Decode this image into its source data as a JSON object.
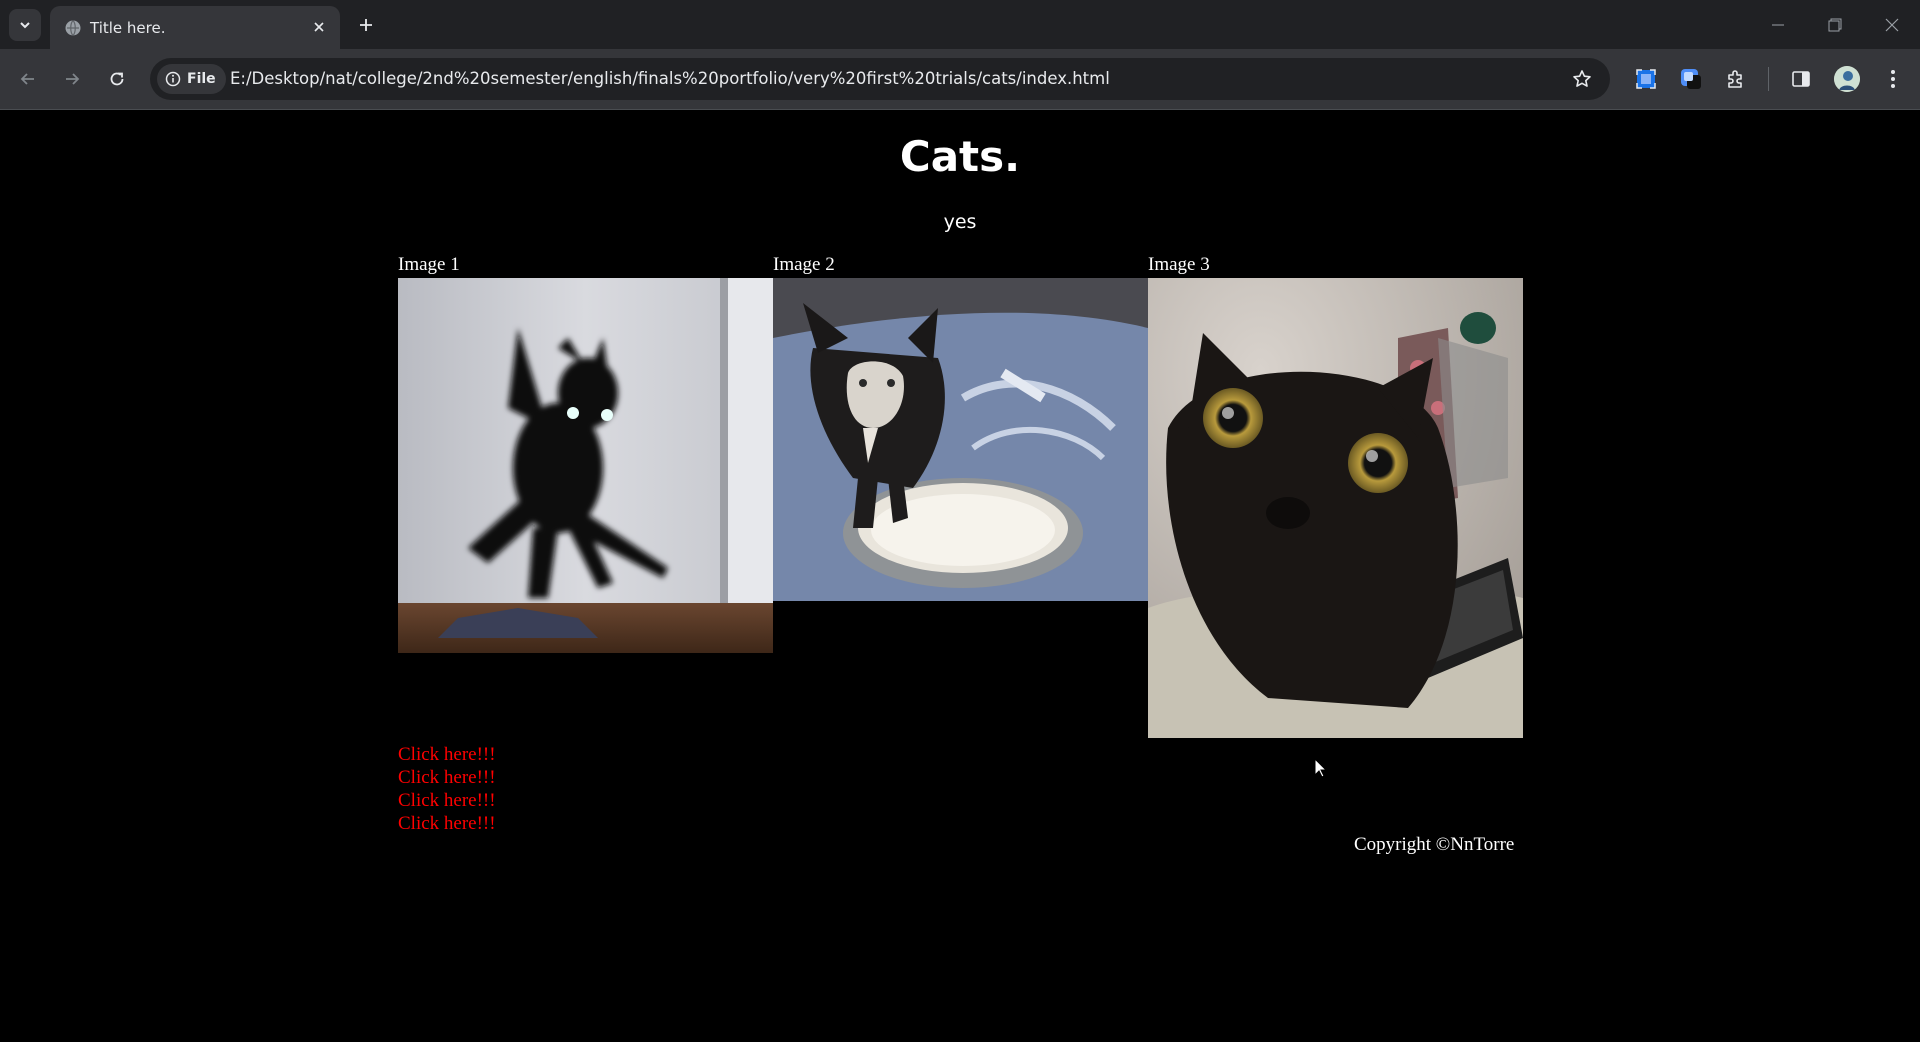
{
  "browser": {
    "tab_title": "Title here.",
    "site_chip_label": "File",
    "url": "E:/Desktop/nat/college/2nd%20semester/english/finals%20portfolio/very%20first%20trials/cats/index.html"
  },
  "page": {
    "title": "Cats.",
    "subtitle": "yes",
    "images": [
      {
        "label": "Image 1",
        "alt": "black kitten jumping"
      },
      {
        "label": "Image 2",
        "alt": "kitten with milk on face"
      },
      {
        "label": "Image 3",
        "alt": "wide-eyed black cat"
      }
    ],
    "links": [
      "Click here!!!",
      "Click here!!!",
      "Click here!!!",
      "Click here!!!"
    ],
    "copyright": "Copyright ©NnTorre"
  },
  "colors": {
    "page_bg": "#000000",
    "link": "#ff0000",
    "text": "#ffffff",
    "chrome_dark": "#202124",
    "chrome_mid": "#35363a"
  }
}
